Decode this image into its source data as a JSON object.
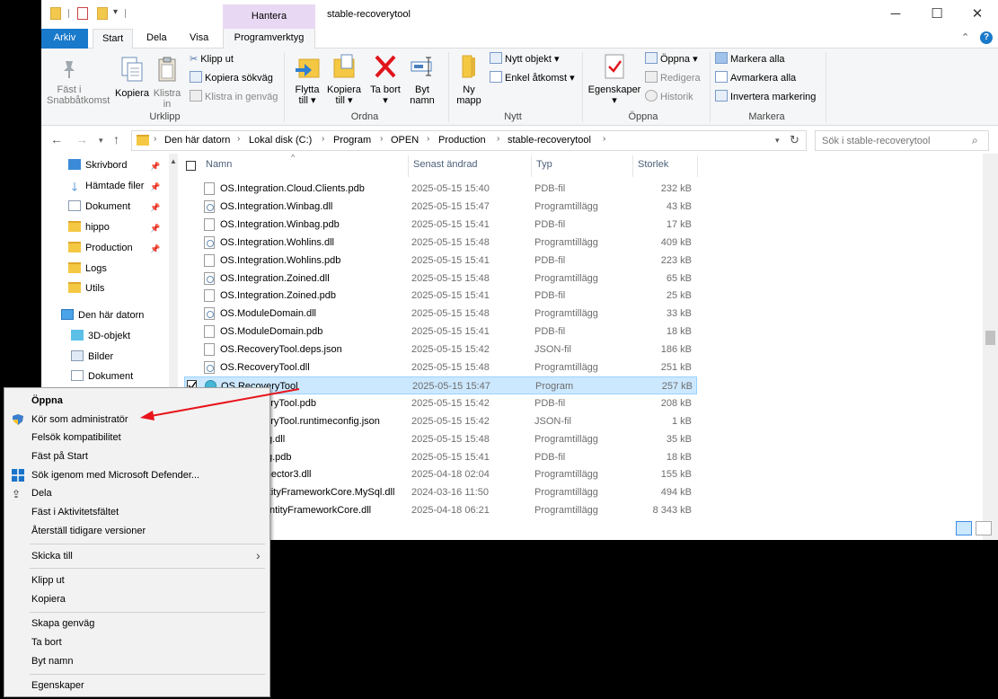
{
  "window": {
    "title": "stable-recoverytool",
    "context_tab_group": "Hantera",
    "controls": {
      "minimize": "─",
      "maximize": "☐",
      "close": "✕"
    }
  },
  "ribbon_tabs": [
    "Arkiv",
    "Start",
    "Dela",
    "Visa",
    "Programverktyg"
  ],
  "ribbon": {
    "urklipp": {
      "label": "Urklipp",
      "pin": "Fäst i Snabbåtkomst",
      "copy": "Kopiera",
      "paste": "Klistra in",
      "cut": "Klipp ut",
      "copy_path": "Kopiera sökväg",
      "paste_shortcut": "Klistra in genväg"
    },
    "ordna": {
      "label": "Ordna",
      "move_to": "Flytta till ▾",
      "copy_to": "Kopiera till ▾",
      "delete": "Ta bort ▾",
      "rename": "Byt namn"
    },
    "nytt": {
      "label": "Nytt",
      "new_folder": "Ny mapp",
      "new_item": "Nytt objekt ▾",
      "easy_access": "Enkel åtkomst ▾"
    },
    "oppna": {
      "label": "Öppna",
      "properties": "Egenskaper ▾",
      "open": "Öppna ▾",
      "edit": "Redigera",
      "history": "Historik"
    },
    "markera": {
      "label": "Markera",
      "select_all": "Markera alla",
      "select_none": "Avmarkera alla",
      "invert": "Invertera markering"
    }
  },
  "address": {
    "segments": [
      "Den här datorn",
      "Lokal disk (C:)",
      "Program",
      "OPEN",
      "Production",
      "stable-recoverytool"
    ],
    "search_placeholder": "Sök i stable-recoverytool"
  },
  "nav": {
    "quick_access": [
      {
        "label": "Skrivbord",
        "pinned": true
      },
      {
        "label": "Hämtade filer",
        "pinned": true
      },
      {
        "label": "Dokument",
        "pinned": true
      },
      {
        "label": "hippo",
        "pinned": true
      },
      {
        "label": "Production",
        "pinned": true
      },
      {
        "label": "Logs",
        "pinned": false
      },
      {
        "label": "Utils",
        "pinned": false
      }
    ],
    "this_pc": "Den här datorn",
    "this_pc_items": [
      "3D-objekt",
      "Bilder",
      "Dokument"
    ]
  },
  "columns": {
    "name": "Namn",
    "date": "Senast ändrad",
    "type": "Typ",
    "size": "Storlek"
  },
  "files": [
    {
      "name": "OS.Integration.Cloud.Clients.pdb",
      "date": "2025-05-15 15:40",
      "type": "PDB-fil",
      "size": "232 kB",
      "kind": "pdb"
    },
    {
      "name": "OS.Integration.Winbag.dll",
      "date": "2025-05-15 15:47",
      "type": "Programtillägg",
      "size": "43 kB",
      "kind": "dll"
    },
    {
      "name": "OS.Integration.Winbag.pdb",
      "date": "2025-05-15 15:41",
      "type": "PDB-fil",
      "size": "17 kB",
      "kind": "pdb"
    },
    {
      "name": "OS.Integration.Wohlins.dll",
      "date": "2025-05-15 15:48",
      "type": "Programtillägg",
      "size": "409 kB",
      "kind": "dll"
    },
    {
      "name": "OS.Integration.Wohlins.pdb",
      "date": "2025-05-15 15:41",
      "type": "PDB-fil",
      "size": "223 kB",
      "kind": "pdb"
    },
    {
      "name": "OS.Integration.Zoined.dll",
      "date": "2025-05-15 15:48",
      "type": "Programtillägg",
      "size": "65 kB",
      "kind": "dll"
    },
    {
      "name": "OS.Integration.Zoined.pdb",
      "date": "2025-05-15 15:41",
      "type": "PDB-fil",
      "size": "25 kB",
      "kind": "pdb"
    },
    {
      "name": "OS.ModuleDomain.dll",
      "date": "2025-05-15 15:48",
      "type": "Programtillägg",
      "size": "33 kB",
      "kind": "dll"
    },
    {
      "name": "OS.ModuleDomain.pdb",
      "date": "2025-05-15 15:41",
      "type": "PDB-fil",
      "size": "18 kB",
      "kind": "pdb"
    },
    {
      "name": "OS.RecoveryTool.deps.json",
      "date": "2025-05-15 15:42",
      "type": "JSON-fil",
      "size": "186 kB",
      "kind": "json"
    },
    {
      "name": "OS.RecoveryTool.dll",
      "date": "2025-05-15 15:48",
      "type": "Programtillägg",
      "size": "251 kB",
      "kind": "dll"
    },
    {
      "name": "OS.RecoveryTool",
      "date": "2025-05-15 15:47",
      "type": "Program",
      "size": "257 kB",
      "kind": "exe",
      "selected": true
    },
    {
      "name": "OS.RecoveryTool.pdb",
      "date": "2025-05-15 15:42",
      "type": "PDB-fil",
      "size": "208 kB",
      "kind": "pdb"
    },
    {
      "name": "OS.RecoveryTool.runtimeconfig.json",
      "date": "2025-05-15 15:42",
      "type": "JSON-fil",
      "size": "1 kB",
      "kind": "json"
    },
    {
      "name": "OS.Logging.dll",
      "date": "2025-05-15 15:48",
      "type": "Programtillägg",
      "size": "35 kB",
      "kind": "dll"
    },
    {
      "name": "OS.Logging.pdb",
      "date": "2025-05-15 15:41",
      "type": "PDB-fil",
      "size": "18 kB",
      "kind": "pdb"
    },
    {
      "name": "MySqlConnector3.dll",
      "date": "2025-04-18 02:04",
      "type": "Programtillägg",
      "size": "155 kB",
      "kind": "dll"
    },
    {
      "name": "Pomelo.EntityFrameworkCore.MySql.dll",
      "date": "2024-03-16 11:50",
      "type": "Programtillägg",
      "size": "494 kB",
      "kind": "dll"
    },
    {
      "name": "Microsoft.EntityFrameworkCore.dll",
      "date": "2025-04-18 06:21",
      "type": "Programtillägg",
      "size": "8 343 kB",
      "kind": "dll"
    }
  ],
  "context_menu": {
    "open": "Öppna",
    "run_as_admin": "Kör som administratör",
    "troubleshoot": "Felsök kompatibilitet",
    "pin_start": "Fäst på Start",
    "defender": "Sök igenom med Microsoft Defender...",
    "share": "Dela",
    "pin_taskbar": "Fäst i Aktivitetsfältet",
    "restore": "Återställ tidigare versioner",
    "send_to": "Skicka till",
    "cut": "Klipp ut",
    "copy": "Kopiera",
    "shortcut": "Skapa genväg",
    "delete": "Ta bort",
    "rename": "Byt namn",
    "properties": "Egenskaper"
  },
  "colors": {
    "accent": "#1979ca",
    "selection": "#cce8ff",
    "annotation_arrow": "#e8151b"
  }
}
